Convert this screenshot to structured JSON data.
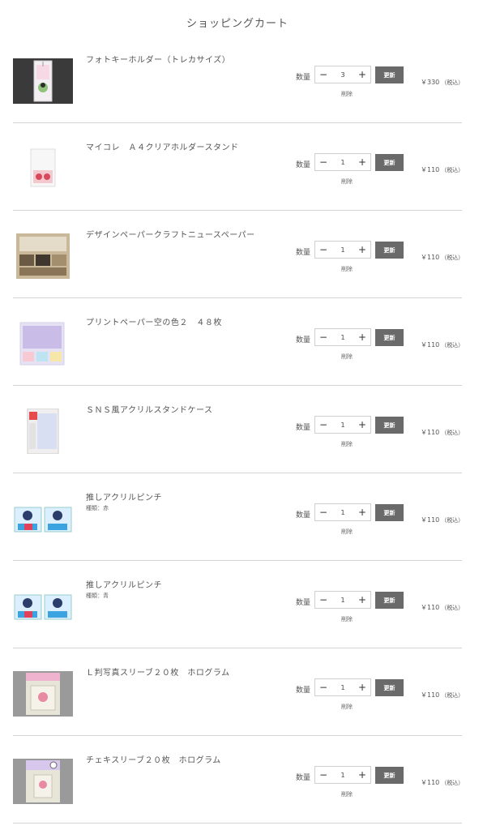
{
  "page_title": "ショッピングカート",
  "labels": {
    "quantity": "数量",
    "update": "更新",
    "delete": "削除",
    "minus": "−",
    "plus": "+"
  },
  "items": [
    {
      "name": "フォトキーホルダー（トレカサイズ）",
      "variant": "",
      "quantity": "3",
      "price": "￥330",
      "tax": "（税込）",
      "thumb_icon": "photo-keyholder-icon"
    },
    {
      "name": "マイコレ　Ａ４クリアホルダースタンド",
      "variant": "",
      "quantity": "1",
      "price": "￥110",
      "tax": "（税込）",
      "thumb_icon": "clear-holder-stand-icon"
    },
    {
      "name": "デザインペーパークラフトニュースペーパー",
      "variant": "",
      "quantity": "1",
      "price": "￥110",
      "tax": "（税込）",
      "thumb_icon": "craft-newspaper-icon"
    },
    {
      "name": "プリントペーパー空の色２　４８枚",
      "variant": "",
      "quantity": "1",
      "price": "￥110",
      "tax": "（税込）",
      "thumb_icon": "print-paper-icon"
    },
    {
      "name": "ＳＮＳ風アクリルスタンドケース",
      "variant": "",
      "quantity": "1",
      "price": "￥110",
      "tax": "（税込）",
      "thumb_icon": "acrylic-stand-case-icon"
    },
    {
      "name": "推しアクリルピンチ",
      "variant": "種類：赤",
      "quantity": "1",
      "price": "￥110",
      "tax": "（税込）",
      "thumb_icon": "acrylic-pinch-icon"
    },
    {
      "name": "推しアクリルピンチ",
      "variant": "種類：青",
      "quantity": "1",
      "price": "￥110",
      "tax": "（税込）",
      "thumb_icon": "acrylic-pinch-icon"
    },
    {
      "name": "Ｌ判写真スリーブ２０枚　ホログラム",
      "variant": "",
      "quantity": "1",
      "price": "￥110",
      "tax": "（税込）",
      "thumb_icon": "photo-sleeve-icon"
    },
    {
      "name": "チェキスリーブ２０枚　ホログラム",
      "variant": "",
      "quantity": "1",
      "price": "￥110",
      "tax": "（税込）",
      "thumb_icon": "cheki-sleeve-icon"
    }
  ],
  "colors": {
    "update_button": "#6a6a6a",
    "divider": "#d4d4d4",
    "text": "#555555"
  }
}
